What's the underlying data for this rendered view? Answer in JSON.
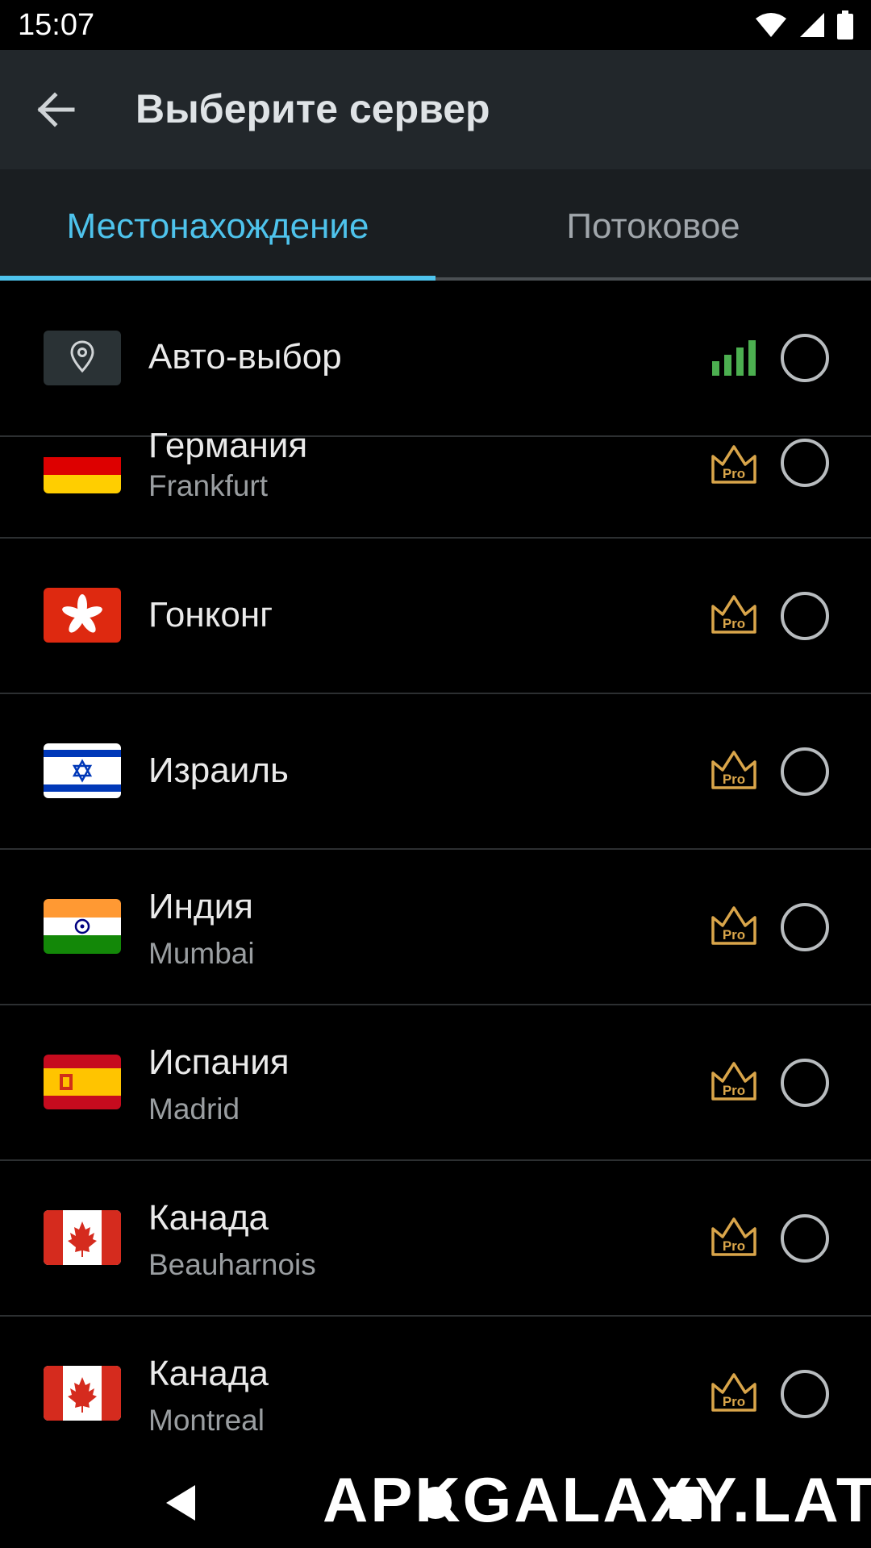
{
  "status_bar": {
    "time": "15:07"
  },
  "app_bar": {
    "title": "Выберите сервер"
  },
  "tabs": [
    {
      "label": "Местонахождение",
      "selected": true
    },
    {
      "label": "Потоковое",
      "selected": false
    }
  ],
  "servers": [
    {
      "country": "Авто-выбор",
      "city": "",
      "badge": "signal"
    },
    {
      "country": "Германия",
      "city": "Frankfurt",
      "badge": "pro"
    },
    {
      "country": "Гонконг",
      "city": "",
      "badge": "pro"
    },
    {
      "country": "Израиль",
      "city": "",
      "badge": "pro"
    },
    {
      "country": "Индия",
      "city": "Mumbai",
      "badge": "pro"
    },
    {
      "country": "Испания",
      "city": "Madrid",
      "badge": "pro"
    },
    {
      "country": "Канада",
      "city": "Beauharnois",
      "badge": "pro"
    },
    {
      "country": "Канада",
      "city": "Montreal",
      "badge": "pro"
    }
  ],
  "pro_badge_text": "Pro",
  "watermark": "APKGALAXY.LAT",
  "colors": {
    "accent": "#4ec3ec",
    "signal": "#4caf50",
    "pro_gold": "#d9a54a",
    "app_bar": "#22272b",
    "tab_bar": "#1a1e21"
  }
}
